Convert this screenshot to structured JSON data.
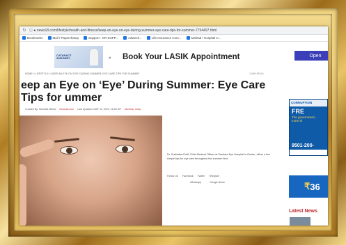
{
  "browser": {
    "url": "ⓘ  ●  news18.com/lifestyle/health-and-fitness/keep-an-eye-on-eye-during-summer-eye-care-tips-for-summer-7754497.html",
    "bookmarks": [
      "Bookmarks",
      "Mail / Paperchamp",
      "Support - KR-SUPP...",
      "Adweek...",
      "Life Insurance Com...",
      "Malnad / Hospital C..."
    ]
  },
  "ad": {
    "thumb_text": "CATARACT SURGERY",
    "title": "Book Your LASIK Appointment",
    "open_label": "Open"
  },
  "article": {
    "breadcrumb": "HOME » LIFESTYLE » KEEP AN EYE ON 'EYE' DURING SUMMER: EYE CARE TIPS FOR SUMMER",
    "read_time": "2 MIN READ",
    "headline": "eep an Eye on ‘Eye’ During Summer: Eye Care Tips for ummer",
    "byline_author": "Curated By: Mrinalini Mehta",
    "byline_source": "News18.com",
    "byline_updated": "Last Updated: MAY 11, 2023, 16:48 IST",
    "byline_location": "Mumbai, India",
    "summary": "Dr. Sudhakar Potti, Chief Medical Officer at Sankara Eye Hospital in Guntur, offers a few simple tips for eye care throughout the summer time",
    "share_label": "Follow Us",
    "share_items": [
      "Facebook",
      "Twitter",
      "Telegram"
    ],
    "share_items2": [
      "Whatsapp",
      "Google News"
    ]
  },
  "sidebar": {
    "ad1_top": "CORRUPTION",
    "ad1_big": "FRE",
    "ad1_sub": "The government... more th",
    "ad1_phone": "9501-200-",
    "ad2_value": "36",
    "ad2_currency": "₹",
    "latest_label": "Latest News"
  }
}
